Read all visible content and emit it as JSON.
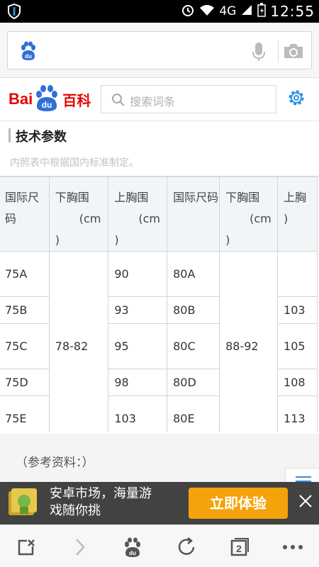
{
  "status_bar": {
    "network": "4G",
    "time": "12:55"
  },
  "search": {
    "placeholder": ""
  },
  "baike": {
    "logo_text": "Bai",
    "logo_du": "du",
    "logo_baike": "百科",
    "search_placeholder": "搜索词条"
  },
  "section": {
    "title": "技术参数",
    "faded_text": "内照表中根据国内标准制定。"
  },
  "table": {
    "headers": [
      "国际尺码",
      "下胸围",
      "上胸围",
      "国际尺码",
      "下胸围",
      "上胸"
    ],
    "header_unit": "(cm",
    "header_close": ")",
    "group1_underbust": "78-82",
    "group2_underbust": "88-92",
    "rows": [
      {
        "size1": "75A",
        "bust1": "90",
        "size2": "80A",
        "bust2": ""
      },
      {
        "size1": "75B",
        "bust1": "93",
        "size2": "80B",
        "bust2": "103"
      },
      {
        "size1": "75C",
        "bust1": "95",
        "size2": "80C",
        "bust2": "105"
      },
      {
        "size1": "75D",
        "bust1": "98",
        "size2": "80D",
        "bust2": "108"
      },
      {
        "size1": "75E",
        "bust1": "103",
        "size2": "80E",
        "bust2": "113"
      }
    ]
  },
  "references": {
    "label": "（参考资料：）"
  },
  "ad": {
    "line1": "安卓市场，海量游",
    "line2": "戏随你挑",
    "button": "立即体验"
  },
  "bottom_nav": {
    "tabs_count": "2"
  },
  "colors": {
    "baidu_red": "#e10601",
    "baidu_blue": "#2f6fd8",
    "accent_orange": "#f5a30a"
  }
}
